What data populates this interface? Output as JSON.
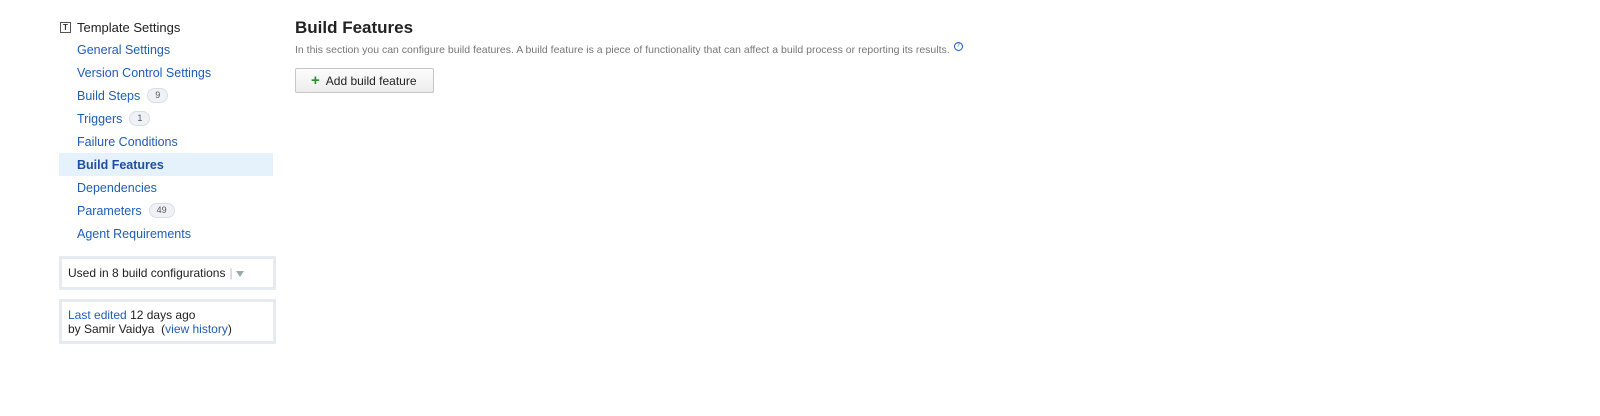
{
  "sidebar": {
    "header": "Template Settings",
    "items": [
      {
        "label": "General Settings",
        "badge": ""
      },
      {
        "label": "Version Control Settings",
        "badge": ""
      },
      {
        "label": "Build Steps",
        "badge": "9"
      },
      {
        "label": "Triggers",
        "badge": "1"
      },
      {
        "label": "Failure Conditions",
        "badge": ""
      },
      {
        "label": "Build Features",
        "badge": ""
      },
      {
        "label": "Dependencies",
        "badge": ""
      },
      {
        "label": "Parameters",
        "badge": "49"
      },
      {
        "label": "Agent Requirements",
        "badge": ""
      }
    ],
    "active_item": "Build Features",
    "used_in": {
      "prefix": "Used in",
      "count": "8",
      "suffix": "build configurations"
    },
    "last_edited": {
      "link": "Last edited",
      "when": "12 days ago",
      "by_prefix": "by Samir Vaidya",
      "history_link": "view history"
    }
  },
  "main": {
    "title": "Build Features",
    "description": "In this section you can configure build features. A build feature is a piece of functionality that can affect a build process or reporting its results.",
    "add_button_label": "Add build feature"
  }
}
